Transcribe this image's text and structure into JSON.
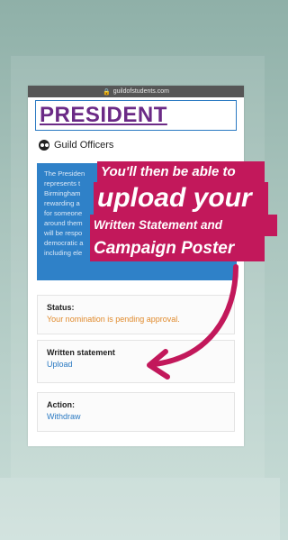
{
  "browser": {
    "url": "guildofstudents.com"
  },
  "page": {
    "title": "PRESIDENT",
    "section": "Guild Officers",
    "description_lines": [
      "The Presiden",
      "represents t",
      "Birmingham",
      "rewarding a",
      "for someone",
      "around them",
      "will be respo",
      "democratic a",
      "including ele"
    ]
  },
  "cards": {
    "status": {
      "label": "Status:",
      "value": "Your nomination is pending approval."
    },
    "statement": {
      "label": "Written statement",
      "link": "Upload"
    },
    "action": {
      "label": "Action:",
      "link": "Withdraw"
    }
  },
  "overlay": {
    "line1": "You'll then be able to",
    "line2": "upload your",
    "line3": "Written Statement and",
    "line4": "Campaign Poster"
  },
  "colors": {
    "accent": "#c2185b",
    "link": "#2a79c2",
    "status": "#e08a2c",
    "title": "#6b2a86"
  }
}
